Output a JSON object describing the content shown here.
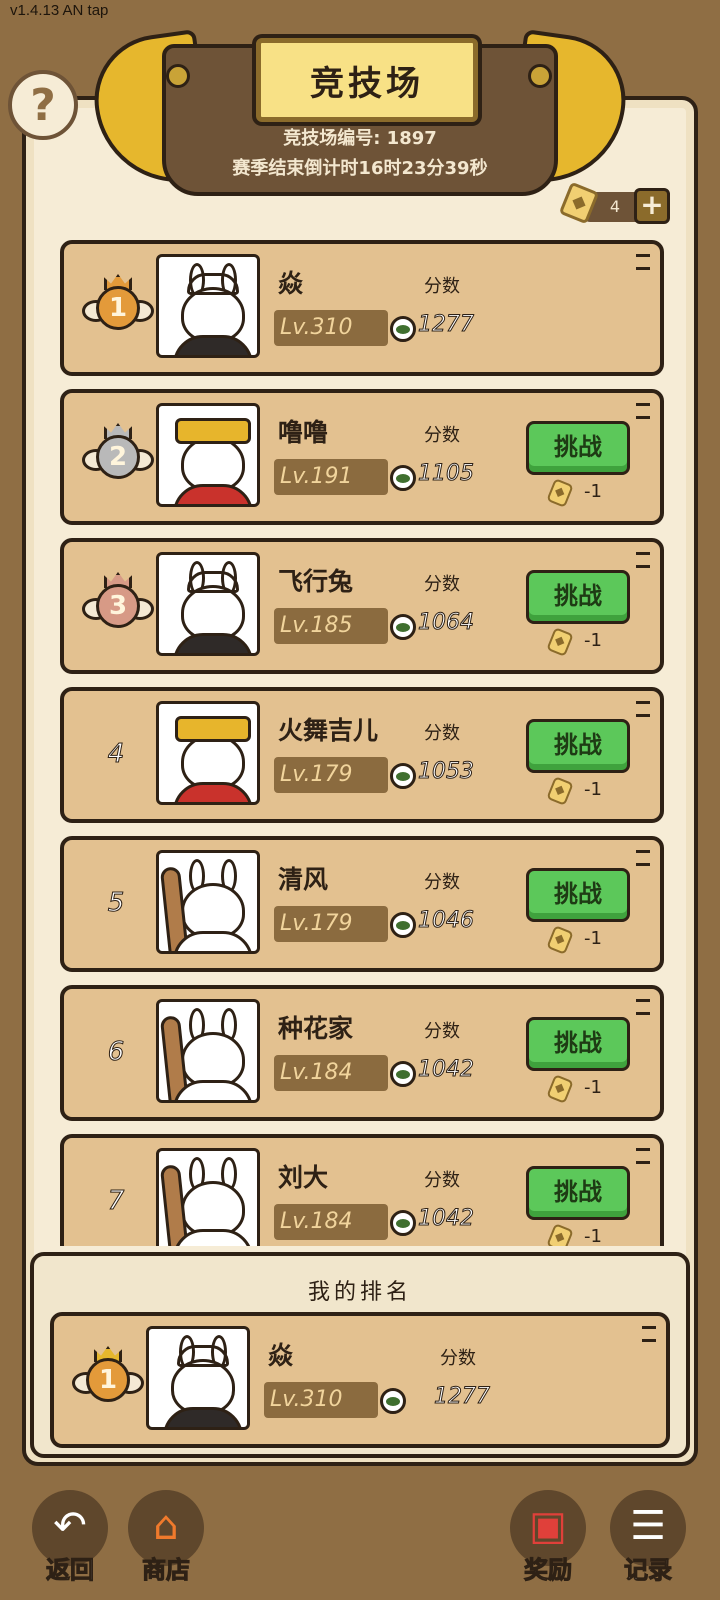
{
  "version": "v1.4.13 AN tap",
  "header": {
    "title": "竞技场",
    "arena_id": "竞技场编号: 1897",
    "countdown": "赛季结束倒计时16时23分39秒"
  },
  "help_label": "?",
  "tickets": {
    "count": "4",
    "plus": "+"
  },
  "score_label": "分数",
  "challenge_label": "挑战",
  "cost_label": "-1",
  "players": [
    {
      "rank": "1",
      "name": "焱",
      "level": "Lv.310",
      "score": "1277",
      "avatar": "bunny-warrior",
      "challenge": false
    },
    {
      "rank": "2",
      "name": "噜噜",
      "level": "Lv.191",
      "score": "1105",
      "avatar": "bunny-empress",
      "challenge": true
    },
    {
      "rank": "3",
      "name": "飞行兔",
      "level": "Lv.185",
      "score": "1064",
      "avatar": "bunny-warrior",
      "challenge": true
    },
    {
      "rank": "4",
      "name": "火舞吉儿",
      "level": "Lv.179",
      "score": "1053",
      "avatar": "bunny-empress",
      "challenge": true
    },
    {
      "rank": "5",
      "name": "清风",
      "level": "Lv.179",
      "score": "1046",
      "avatar": "bunny-club",
      "challenge": true
    },
    {
      "rank": "6",
      "name": "种花家",
      "level": "Lv.184",
      "score": "1042",
      "avatar": "bunny-club",
      "challenge": true
    },
    {
      "rank": "7",
      "name": "刘大",
      "level": "Lv.184",
      "score": "1042",
      "avatar": "bunny-club",
      "challenge": true
    }
  ],
  "my_ranking": {
    "title": "我的排名",
    "rank": "1",
    "name": "焱",
    "level": "Lv.310",
    "score_label": "分数",
    "score": "1277"
  },
  "nav": {
    "back": "返回",
    "shop": "商店",
    "rewards": "奖励",
    "records": "记录"
  },
  "colors": {
    "background": "#8f6e44",
    "panel": "#f6ecd6",
    "row": "#e3c190",
    "challenge_green": "#5cc85a",
    "gold": "#e6b72d",
    "silver": "#bdbdbd",
    "bronze": "#c98a6a"
  }
}
